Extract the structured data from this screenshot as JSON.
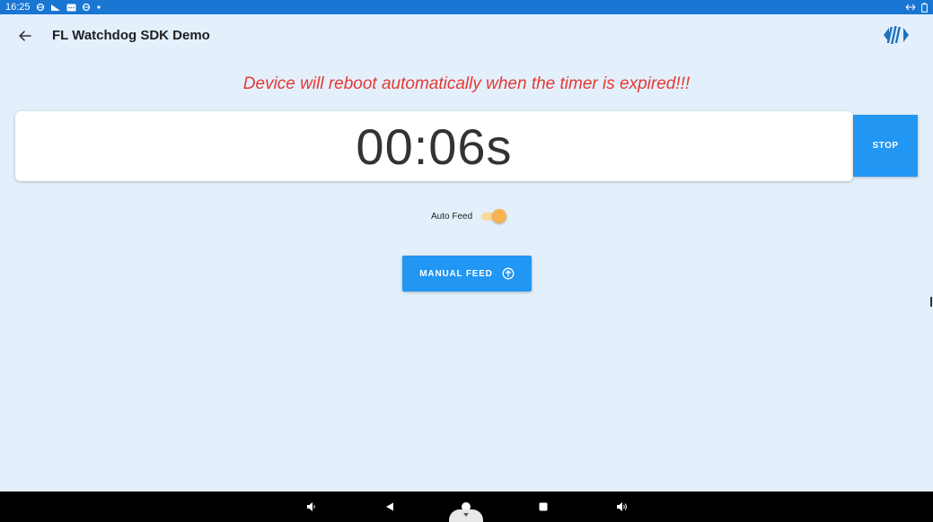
{
  "status_bar": {
    "time": "16:25",
    "left_icons": [
      "sync-icon",
      "signal-icon",
      "message-icon",
      "sync-icon",
      "dot-icon"
    ],
    "right_icons": [
      "data-arrows-icon",
      "battery-icon"
    ]
  },
  "app_bar": {
    "title": "FL Watchdog SDK Demo"
  },
  "warning": {
    "text": "Device will reboot automatically when the timer is expired!!!",
    "color": "#e53935"
  },
  "timer": {
    "value": "00:06s"
  },
  "stop_button": {
    "label": "STOP"
  },
  "auto_feed": {
    "label": "Auto Feed",
    "enabled": true
  },
  "manual_feed": {
    "label": "MANUAL FEED"
  },
  "colors": {
    "background": "#e3f0fc",
    "status_bar": "#1976d2",
    "accent": "#2196f3",
    "toggle_on": "#f7b352"
  }
}
